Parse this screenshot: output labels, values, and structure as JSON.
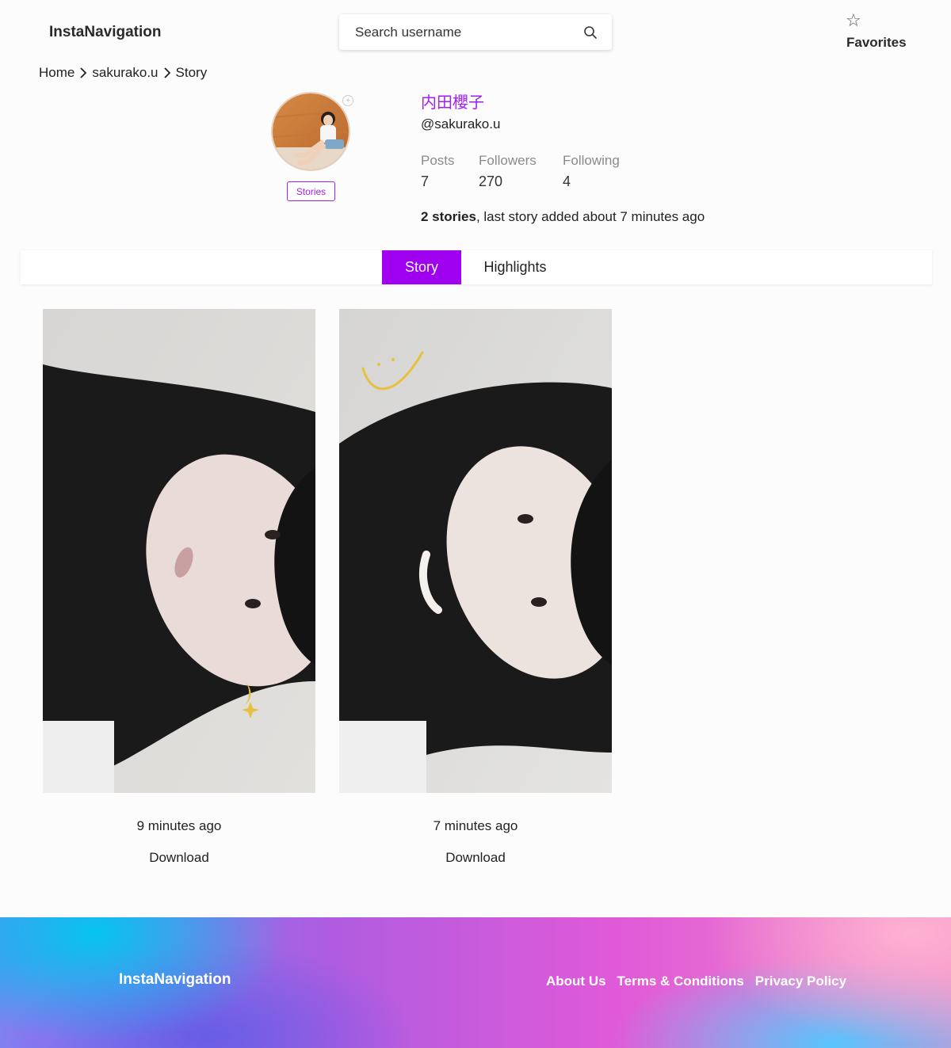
{
  "header": {
    "brand": "InstaNavigation",
    "search_placeholder": "Search username",
    "favorites_label": "Favorites"
  },
  "breadcrumb": {
    "items": [
      "Home",
      "sakurako.u",
      "Story"
    ]
  },
  "profile": {
    "full_name": "内田櫻子",
    "username": "@sakurako.u",
    "stories_button": "Stories",
    "stats": [
      {
        "label": "Posts",
        "value": "7"
      },
      {
        "label": "Followers",
        "value": "270"
      },
      {
        "label": "Following",
        "value": "4"
      }
    ],
    "summary_bold": "2 stories",
    "summary_rest": ", last story added about 7 minutes ago"
  },
  "tabs": [
    {
      "label": "Story",
      "active": true
    },
    {
      "label": "Highlights",
      "active": false
    }
  ],
  "stories": [
    {
      "time": "9 minutes ago",
      "download": "Download"
    },
    {
      "time": "7 minutes ago",
      "download": "Download"
    }
  ],
  "footer": {
    "brand": "InstaNavigation",
    "links": [
      "About Us",
      "Terms & Conditions",
      "Privacy Policy"
    ]
  },
  "colors": {
    "accent": "#a000f0"
  }
}
